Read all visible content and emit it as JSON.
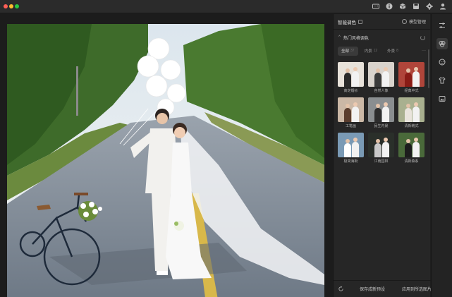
{
  "window": {
    "traffic_lights": [
      "#ff5f57",
      "#febc2e",
      "#28c840"
    ]
  },
  "titlebar": {
    "icons": [
      "keyboard-icon",
      "info-icon",
      "cube-icon",
      "save-icon",
      "gear-icon",
      "user-icon"
    ]
  },
  "panel": {
    "title": "智能调色",
    "manage_label": "模型管理",
    "section_title": "热门风格调色",
    "tabs": [
      {
        "label": "全部",
        "count": "37"
      },
      {
        "label": "内景",
        "count": "12"
      },
      {
        "label": "外景",
        "count": "8"
      }
    ],
    "more_label": "···",
    "presets": [
      {
        "label": "高定婚纱",
        "bg": "#e8e2da",
        "accent": "#2a2a2a"
      },
      {
        "label": "自然人像",
        "bg": "#d9d3cc",
        "accent": "#3a3a3a"
      },
      {
        "label": "经典中式",
        "bg": "#b0453a",
        "accent": "#8a1c16"
      },
      {
        "label": "工笔画",
        "bg": "#cbb8a6",
        "accent": "#5a3d2e"
      },
      {
        "label": "民生内景",
        "bg": "#8a8e90",
        "accent": "#2d2d2d"
      },
      {
        "label": "清新韩式",
        "bg": "#a9b08f",
        "accent": "#e9e4dc"
      },
      {
        "label": "极简海街",
        "bg": "#7a9ab5",
        "accent": "#ffffff"
      },
      {
        "label": "江南园林",
        "bg": "#2a2f2a",
        "accent": "#c9c9c9"
      },
      {
        "label": "清新森系",
        "bg": "#4a6a3a",
        "accent": "#1d1d1d"
      }
    ],
    "footer": {
      "save_label": "保存成新预设",
      "apply_label": "应用到所选图片"
    }
  },
  "toolrail": {
    "icons": [
      "sliders-icon",
      "palette-icon",
      "face-retouch-icon",
      "shirt-icon",
      "image-icon"
    ],
    "active_index": 1
  }
}
